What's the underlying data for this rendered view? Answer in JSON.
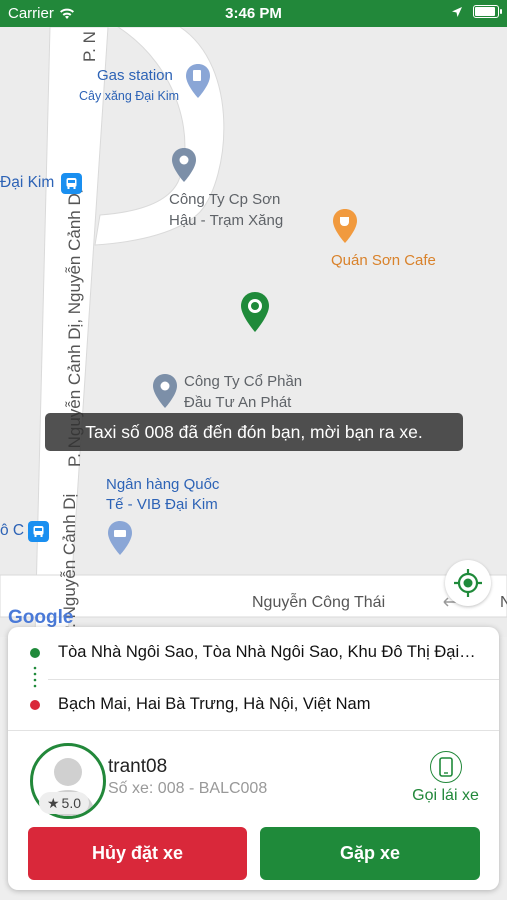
{
  "status_bar": {
    "carrier": "Carrier",
    "time": "3:46 PM"
  },
  "map": {
    "labels": {
      "gas_station": "Gas station",
      "gas_station_sub": "Cây xăng Đại Kim",
      "dai_kim": "Đại Kim",
      "cong_ty_son_hau_1": "Công Ty Cp Sơn",
      "cong_ty_son_hau_2": "Hậu - Trạm Xăng",
      "quan_son_cafe": "Quán Sơn Cafe",
      "an_phat_1": "Công Ty Cổ Phần",
      "an_phat_2": "Đầu Tư An Phát",
      "vib_1": "Ngân hàng Quốc",
      "vib_2": "Tế - VIB Đại Kim",
      "bus_oc": "ô C",
      "road_p_n": "P. N",
      "road_nguyen_canh_di": "P. Nguyễn Cảnh Dị, Nguyễn Cảnh Dị",
      "road_nguyen_canh_di_2": "P. Nguyễn Cảnh Dị",
      "road_nguyen_cong_thai": "Nguyễn Công Thái",
      "road_n_right": "N",
      "google": "Google"
    }
  },
  "toast": "Taxi số 008 đã đến đón bạn, mời bạn ra xe.",
  "trip": {
    "pickup": "Tòa Nhà Ngôi Sao, Tòa Nhà Ngôi Sao, Khu Đô Thị Đại…",
    "dropoff": "Bạch Mai, Hai Bà Trưng, Hà Nội, Việt Nam"
  },
  "driver": {
    "name": "trant08",
    "plate": "Số xe: 008 - BALC008",
    "rating": "5.0",
    "call_label": "Gọi lái xe"
  },
  "buttons": {
    "cancel": "Hủy đặt xe",
    "meet": "Gặp xe"
  },
  "colors": {
    "brand_green": "#22883a",
    "cancel_red": "#d9283a"
  }
}
